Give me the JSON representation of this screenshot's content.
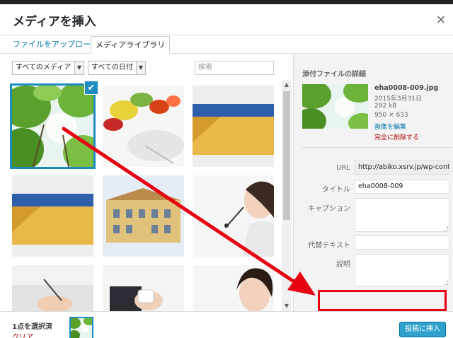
{
  "modal": {
    "title": "メディアを挿入",
    "close_icon": "×"
  },
  "tabs": [
    {
      "label": "ファイルをアップロード",
      "active": false
    },
    {
      "label": "メディアライブラリ",
      "active": true
    }
  ],
  "filters": {
    "media_type": "すべてのメディア",
    "date": "すべての日付",
    "search_placeholder": "検索"
  },
  "grid": {
    "items": [
      {
        "name": "forest-canopy",
        "selected": true
      },
      {
        "name": "vegetables-plate",
        "selected": false
      },
      {
        "name": "house-wall-blue",
        "selected": false
      },
      {
        "name": "house-wall-blue-2",
        "selected": false
      },
      {
        "name": "yellow-building",
        "selected": false
      },
      {
        "name": "headset-woman",
        "selected": false
      },
      {
        "name": "hands-pen",
        "selected": false
      },
      {
        "name": "coffee-cup",
        "selected": false
      },
      {
        "name": "woman-portrait",
        "selected": false
      }
    ]
  },
  "details": {
    "heading": "添付ファイルの詳細",
    "filename": "eha0008-009.jpg",
    "date": "2015年3月31日",
    "filesize": "292 kB",
    "dimensions": "950 × 633",
    "edit_link": "画像を編集",
    "delete_link": "完全に削除する",
    "fields": {
      "url_label": "URL",
      "url_value": "http://abiko.xsrv.jp/wp-cont",
      "title_label": "タイトル",
      "title_value": "eha0008-009",
      "caption_label": "キャプション",
      "caption_value": "",
      "alt_label": "代替テキスト",
      "alt_value": "",
      "description_label": "説明",
      "description_value": ""
    }
  },
  "footer": {
    "selected_count": "1点を選択済",
    "clear_link": "クリア",
    "insert_button": "投稿に挿入"
  },
  "colors": {
    "accent": "#1e8cbe",
    "annotation_red": "#e60012",
    "insert_button": "#2ea2cc"
  }
}
